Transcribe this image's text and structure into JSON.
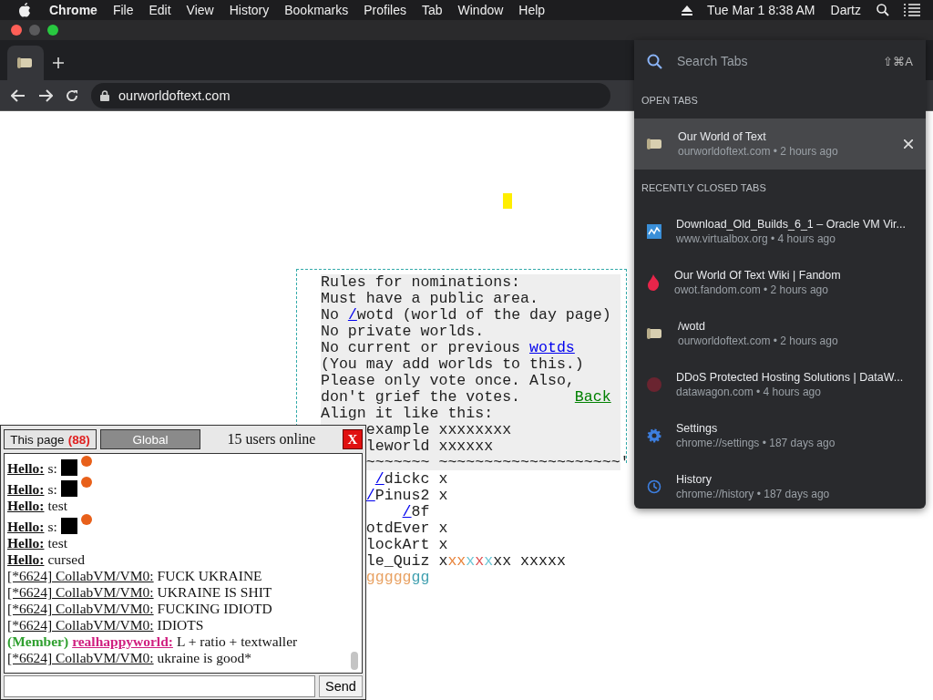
{
  "menubar": {
    "app": "Chrome",
    "items": [
      "File",
      "Edit",
      "View",
      "History",
      "Bookmarks",
      "Profiles",
      "Tab",
      "Window",
      "Help"
    ],
    "clock": "Tue Mar 1  8:38 AM",
    "user": "Dartz"
  },
  "toolbar": {
    "url": "ourworldoftext.com"
  },
  "canvas": {
    "rows": [
      {
        "segs": [
          {
            "text": "Rules for nominations:"
          }
        ]
      },
      {
        "segs": [
          {
            "text": "Must have a public area."
          }
        ]
      },
      {
        "segs": [
          {
            "text": "No "
          },
          {
            "text": "/",
            "link": true,
            "color": "#0000ee"
          },
          {
            "text": "wotd (world of the day page)"
          }
        ]
      },
      {
        "segs": [
          {
            "text": "No private worlds."
          }
        ]
      },
      {
        "segs": [
          {
            "text": "No current or previous "
          },
          {
            "text": "wotds",
            "link": true,
            "color": "#0000ee"
          }
        ]
      },
      {
        "segs": [
          {
            "text": "(You may add worlds to this.)"
          }
        ]
      },
      {
        "segs": [
          {
            "text": "Please only vote once. Also,"
          }
        ]
      },
      {
        "segs": [
          {
            "text": "don't grief the votes.      "
          },
          {
            "text": "Back",
            "link": true,
            "color": "#008000"
          }
        ]
      },
      {
        "segs": [
          {
            "text": "Align it like this:"
          }
        ]
      },
      {
        "segs": [
          {
            "text": "example xxxxxxxx"
          }
        ]
      },
      {
        "segs": [
          {
            "text": "leworld xxxxxx"
          }
        ]
      },
      {
        "segs": [
          {
            "text": "~~~~~~~ ~~~~~~~~~~~~~~~~~~~~'"
          }
        ]
      },
      {
        "segs": [
          {
            "text": "/",
            "link": true,
            "color": "#0000ee"
          },
          {
            "text": "dickc x"
          }
        ]
      },
      {
        "segs": [
          {
            "text": "/",
            "link": true,
            "color": "#0000ee"
          },
          {
            "text": "Pinus2 x"
          }
        ]
      },
      {
        "segs": [
          {
            "text": "/",
            "link": true,
            "color": "#0000ee"
          },
          {
            "text": "8f"
          }
        ]
      },
      {
        "segs": [
          {
            "text": "otdEver x"
          }
        ]
      },
      {
        "segs": [
          {
            "text": "lockArt x"
          }
        ]
      },
      {
        "segs": [
          {
            "text": "le_Quiz x"
          },
          {
            "text": "xx",
            "color": "#e8833a"
          },
          {
            "text": "x",
            "color": "#6cc6d6"
          },
          {
            "text": "x",
            "color": "#e05050"
          },
          {
            "text": "x",
            "color": "#6cc6d6"
          },
          {
            "text": "xx xxxxx"
          }
        ]
      },
      {
        "segs": [
          {
            "text": "ggggg",
            "color": "#e8a060"
          },
          {
            "text": "gg",
            "color": "#40a0b0"
          }
        ]
      }
    ]
  },
  "chat": {
    "tabs": [
      {
        "label": "This page",
        "count": "(88)",
        "selected": true
      },
      {
        "label": "Global",
        "selected": false
      }
    ],
    "online": "15 users online",
    "close": "X",
    "messages": [
      {
        "kind": "nick",
        "name": "Hello:",
        "text": "s:",
        "emote": true
      },
      {
        "kind": "nick",
        "name": "Hello:",
        "text": "s:",
        "emote": true
      },
      {
        "kind": "nick",
        "name": "Hello:",
        "text": "test",
        "emote": false
      },
      {
        "kind": "nick",
        "name": "Hello:",
        "text": "s:",
        "emote": true
      },
      {
        "kind": "nick",
        "name": "Hello:",
        "text": "test",
        "emote": false
      },
      {
        "kind": "nick",
        "name": "Hello:",
        "text": "cursed",
        "emote": false
      },
      {
        "kind": "user",
        "name": "[*6624] CollabVM/VM0:",
        "text": "FUCK UKRAINE",
        "emote": false
      },
      {
        "kind": "user",
        "name": "[*6624] CollabVM/VM0:",
        "text": "UKRAINE IS SHIT",
        "emote": false
      },
      {
        "kind": "user",
        "name": "[*6624] CollabVM/VM0:",
        "text": "FUCKING IDIOTD",
        "emote": false
      },
      {
        "kind": "user",
        "name": "[*6624] CollabVM/VM0:",
        "text": "IDIOTS",
        "emote": false
      },
      {
        "kind": "member",
        "rank": "(Member)",
        "name": "realhappyworld:",
        "text": "L + ratio + textwaller",
        "emote": false
      },
      {
        "kind": "user",
        "name": "[*6624] CollabVM/VM0:",
        "text": "ukraine is good*",
        "emote": false
      }
    ],
    "send": "Send"
  },
  "tab_search": {
    "placeholder": "Search Tabs",
    "shortcut": "⇧⌘A",
    "sections": [
      {
        "title": "OPEN TABS",
        "items": [
          {
            "title": "Our World of Text",
            "subtitle": "ourworldoftext.com • 2 hours ago",
            "selected": true
          }
        ]
      },
      {
        "title": "RECENTLY CLOSED TABS",
        "items": [
          {
            "title": "Download_Old_Builds_6_1 – Oracle VM Vir...",
            "subtitle": "www.virtualbox.org • 4 hours ago",
            "selected": false
          },
          {
            "title": "Our World Of Text Wiki | Fandom",
            "subtitle": "owot.fandom.com • 2 hours ago",
            "selected": false
          },
          {
            "title": "/wotd",
            "subtitle": "ourworldoftext.com • 2 hours ago",
            "selected": false
          },
          {
            "title": "DDoS Protected Hosting Solutions | DataW...",
            "subtitle": "datawagon.com • 4 hours ago",
            "selected": false
          },
          {
            "title": "Settings",
            "subtitle": "chrome://settings • 187 days ago",
            "selected": false
          },
          {
            "title": "History",
            "subtitle": "chrome://history • 187 days ago",
            "selected": false
          }
        ]
      }
    ]
  }
}
